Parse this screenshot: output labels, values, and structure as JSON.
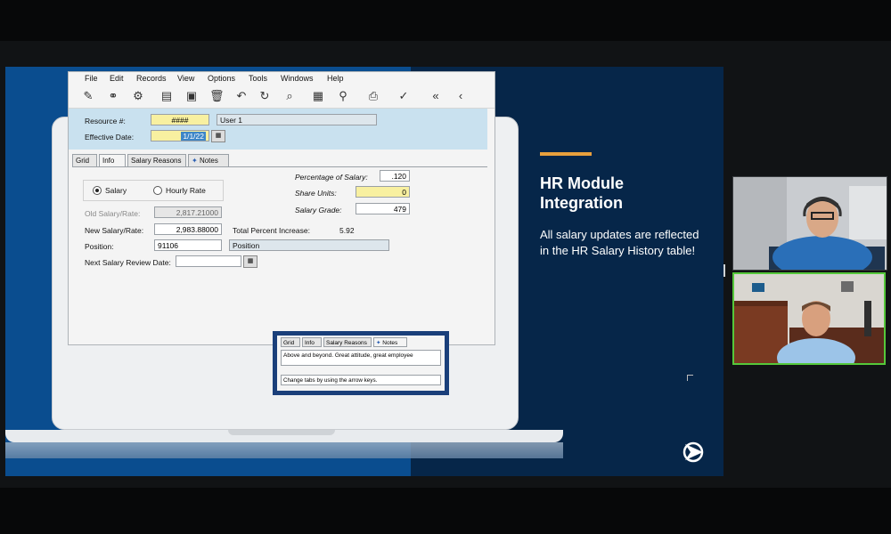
{
  "slide": {
    "title": "HR Module Integration",
    "body": "All salary updates are reflected in the HR Salary History table!"
  },
  "colors": {
    "slide_bg": "#062649",
    "slide_left_bg": "#0a4d8f",
    "accent": "#e8a03c",
    "panel_blue": "#c9e1ef",
    "field_yellow": "#f8f0a0",
    "active_speaker_border": "#55c83a"
  },
  "app": {
    "menu": [
      "File",
      "Edit",
      "Records",
      "View",
      "Options",
      "Tools",
      "Windows",
      "Help"
    ],
    "toolbar_icons": [
      "edit-icon",
      "binoculars-icon",
      "gear-icon",
      "new-document-icon",
      "save-icon",
      "delete-icon",
      "undo-icon",
      "refresh-icon",
      "search-icon",
      "grid-icon",
      "attachment-icon",
      "print-icon",
      "spell-check-icon",
      "first-record-icon",
      "previous-record-icon"
    ],
    "header": {
      "resource_label": "Resource #:",
      "resource_value": "####",
      "resource_name": "User 1",
      "effective_date_label": "Effective Date:",
      "effective_date_value": "1/1/22"
    },
    "tabs": [
      "Grid",
      "Info",
      "Salary Reasons",
      "Notes"
    ],
    "active_tab": "Info",
    "form": {
      "salary_radio": "Salary",
      "hourly_radio": "Hourly Rate",
      "selected_rate_type": "Salary",
      "old_salary_label": "Old Salary/Rate:",
      "old_salary_value": "2,817.21000",
      "new_salary_label": "New Salary/Rate:",
      "new_salary_value": "2,983.88000",
      "position_label": "Position:",
      "position_value": "91106",
      "position_name": "Position",
      "next_review_label": "Next Salary Review Date:",
      "next_review_value": "",
      "total_increase_label": "Total Percent Increase:",
      "total_increase_value": "5.92",
      "pct_salary_label": "Percentage of Salary:",
      "pct_salary_value": ".120",
      "share_units_label": "Share Units:",
      "share_units_value": "0",
      "salary_grade_label": "Salary Grade:",
      "salary_grade_value": "479"
    },
    "notes_popup": {
      "tabs": [
        "Grid",
        "Info",
        "Salary Reasons",
        "Notes"
      ],
      "active_tab": "Notes",
      "note_text": "Above and beyond. Great attitude, great employee",
      "status_text": "Change tabs by using the arrow keys."
    }
  },
  "participants": [
    {
      "tile": "video1",
      "description_icon": "participant-video-icon"
    },
    {
      "tile": "video2",
      "description_icon": "participant-video-icon",
      "active_speaker": true
    }
  ]
}
